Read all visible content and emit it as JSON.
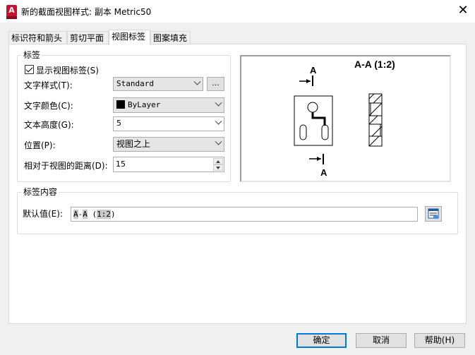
{
  "window": {
    "title": "新的截面视图样式: 副本 Metric50",
    "app_icon_letter": "A",
    "close_glyph": "✕"
  },
  "tabs": [
    "标识符和箭头",
    "剪切平面",
    "视图标签",
    "图案填充"
  ],
  "active_tab": 2,
  "label_group": {
    "title": "标签",
    "show_label": {
      "label": "显示视图标签(S)",
      "checked": true
    },
    "text_style": {
      "label": "文字样式(T):",
      "value": "Standard",
      "browse": "..."
    },
    "text_color": {
      "label": "文字颜色(C):",
      "value": "ByLayer",
      "swatch_color": "#000000"
    },
    "text_height": {
      "label": "文本高度(G):",
      "value": "5"
    },
    "position": {
      "label": "位置(P):",
      "value": "视图之上"
    },
    "distance": {
      "label": "相对于视图的距离(D):",
      "value": "15"
    }
  },
  "preview": {
    "title": "A-A (1:2)",
    "marker_top": "A",
    "marker_bottom": "A"
  },
  "content_group": {
    "title": "标签内容",
    "default_label": "默认值(E):",
    "default_value": {
      "part1": "A",
      "part2": "-",
      "part3": "A",
      "part4": " (",
      "part5": "1:2",
      "part6": ")"
    }
  },
  "buttons": {
    "ok": "确定",
    "cancel": "取消",
    "help": "帮助(H)"
  }
}
